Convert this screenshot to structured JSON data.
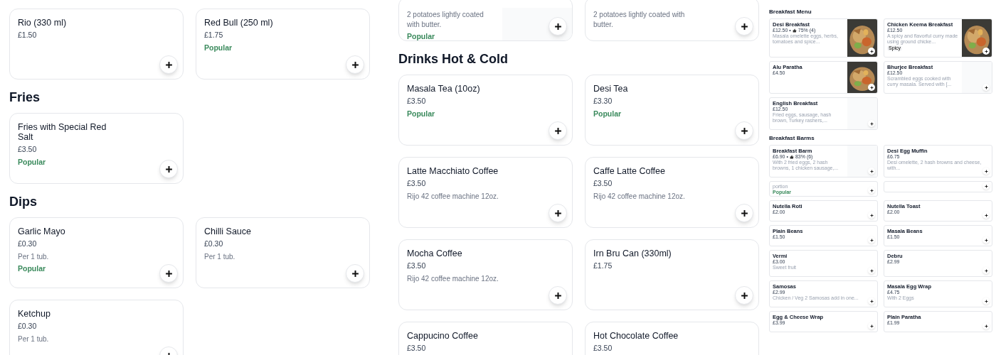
{
  "panels": [
    {
      "sections": [
        {
          "items": [
            {
              "name": "Rio (330 ml)",
              "price": "£1.50"
            },
            {
              "name": "Red Bull (250 ml)",
              "price": "£1.75",
              "tags": [
                {
                  "text": "Popular",
                  "kind": "popular"
                }
              ]
            }
          ]
        },
        {
          "title": "Fries",
          "items": [
            {
              "name": "Fries with Special Red Salt",
              "price": "£3.50",
              "tags": [
                {
                  "text": "Popular",
                  "kind": "popular"
                }
              ]
            }
          ]
        },
        {
          "title": "Dips",
          "items": [
            {
              "name": "Garlic Mayo",
              "price": "£0.30",
              "description": "Per 1 tub.",
              "tags": [
                {
                  "text": "Popular",
                  "kind": "popular"
                }
              ]
            },
            {
              "name": "Chilli Sauce",
              "price": "£0.30",
              "description": "Per 1 tub."
            },
            {
              "name": "Ketchup",
              "price": "£0.30",
              "description": "Per 1 tub."
            }
          ]
        }
      ]
    },
    {
      "sections": [
        {
          "cut_off": true,
          "items": [
            {
              "description": "2 potatoes lightly coated with butter.",
              "blank_image": true,
              "tags": [
                {
                  "text": "Popular",
                  "kind": "popular"
                }
              ]
            },
            {
              "description": "2 potatoes lightly coated with butter."
            }
          ]
        },
        {
          "title": "Drinks Hot & Cold",
          "items": [
            {
              "name": "Masala Tea (10oz)",
              "price": "£3.50",
              "tags": [
                {
                  "text": "Popular",
                  "kind": "popular"
                }
              ]
            },
            {
              "name": "Desi Tea",
              "price": "£3.30",
              "tags": [
                {
                  "text": "Popular",
                  "kind": "popular"
                }
              ]
            },
            {
              "name": "Latte Macchiato Coffee",
              "price": "£3.50",
              "description": "Rijo 42 coffee machine 12oz."
            },
            {
              "name": "Caffe Latte Coffee",
              "price": "£3.50",
              "description": "Rijo 42 coffee machine 12oz."
            },
            {
              "name": "Mocha Coffee",
              "price": "£3.50",
              "description": "Rijo 42 coffee machine 12oz."
            },
            {
              "name": "Irn Bru Can (330ml)",
              "price": "£1.75"
            },
            {
              "name": "Cappucino Coffee",
              "price": "£3.50"
            },
            {
              "name": "Hot Chocolate Coffee",
              "price": "£3.50"
            }
          ]
        }
      ]
    },
    {
      "sections": [
        {
          "title": "Breakfast Menu",
          "items": [
            {
              "name": "Desi Breakfast",
              "price": "£12.50 •",
              "rating": "75% (4)",
              "description": "Masala omelette eggs, herbs, tomatoes and spice...",
              "photo": true
            },
            {
              "name": "Chicken Keema Breakfast",
              "price": "£12.50",
              "description": "A spicy and flavorful curry made using ground chicke...",
              "photo": true,
              "tags": [
                {
                  "text": "Spicy",
                  "kind": "pill"
                }
              ]
            },
            {
              "name": "Alu Paratha",
              "price": "£4.50",
              "photo": true
            },
            {
              "name": "Bhurjee Breakfast",
              "price": "£12.50",
              "description": "Scrambled eggs cooked with curry masala. Served with [...",
              "blank_image": true
            },
            {
              "name": "English Breakfast",
              "price": "£12.50",
              "description": "Fried eggs, sausage, hash brown, Turkey rashers,...",
              "blank_image": true
            }
          ]
        },
        {
          "title": "Breakfast Barms",
          "items": [
            {
              "name": "Breakfast Barm",
              "price": "£6.90 •",
              "rating": "83% (6)",
              "description": "With 2 fried eggs, 2 hash browns, 1 chicken sausage,...",
              "blank_image": true
            },
            {
              "name": "Desi Egg Muffin",
              "price": "£6.75",
              "description": "Desi omelette, 2 hash browns and cheese, with..."
            },
            {
              "description": "portion",
              "tags": [
                {
                  "text": "Popular",
                  "kind": "popular"
                }
              ]
            },
            {
              "cut_off": true
            },
            {
              "name": "Nutella Roti",
              "price": "£2.00"
            },
            {
              "name": "Nutella Toast",
              "price": "£2.00"
            },
            {
              "name": "Plain Beans",
              "price": "£1.50"
            },
            {
              "name": "Masala Beans",
              "price": "£1.50"
            },
            {
              "name": "Vermi",
              "price": "£3.00",
              "description": "Sweet fruit"
            },
            {
              "name": "Debru",
              "price": "£2.99"
            },
            {
              "name": "Samosas",
              "price": "£2.99",
              "description": "Chicken / Veg 2 Samosas add in one..."
            },
            {
              "name": "Masala Egg Wrap",
              "price": "£4.75",
              "description": "With 2 Eggs"
            },
            {
              "name": "Egg & Cheese Wrap",
              "price": "£3.99"
            },
            {
              "name": "Plain Paratha",
              "price": "£1.99"
            }
          ]
        }
      ]
    }
  ]
}
